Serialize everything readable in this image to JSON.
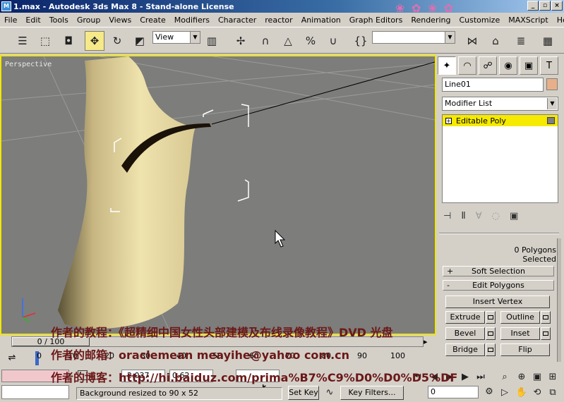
{
  "window": {
    "title": "1.max - Autodesk 3ds Max 8 - Stand-alone License",
    "controls": [
      "_",
      "▫",
      "×"
    ]
  },
  "menu": [
    "File",
    "Edit",
    "Tools",
    "Group",
    "Views",
    "Create",
    "Modifiers",
    "Character",
    "reactor",
    "Animation",
    "Graph Editors",
    "Rendering",
    "Customize",
    "MAXScript",
    "Help"
  ],
  "toolbar": {
    "coord_system": "View",
    "named_selection": ""
  },
  "viewport": {
    "label": "Perspective",
    "overlay_lines": [
      "作者的教程：《超精细中国女性头部建模及布线录像教程》DVD 光盘",
      "作者的邮箱：oraclemean meayihe@yahoo com.cn",
      "作者的博客：http://hi.baiduz.com/prima%B7%C9%D0%D0%D5%DF"
    ]
  },
  "command_panel": {
    "object_name": "Line01",
    "modifier_list": "Modifier List",
    "stack_item": "Editable Poly",
    "selection_status": "0 Polygons Selected",
    "rollouts": {
      "soft_selection": "Soft Selection",
      "edit_polygons": "Edit Polygons"
    },
    "buttons": {
      "insert_vertex": "Insert Vertex",
      "extrude": "Extrude",
      "outline": "Outline",
      "bevel": "Bevel",
      "inset": "Inset",
      "bridge": "Bridge",
      "flip": "Flip"
    },
    "signs": {
      "plus": "+",
      "minus": "-"
    }
  },
  "timeline": {
    "frame_label": "0 / 100",
    "current_frame": 0,
    "ticks": [
      "0",
      "10",
      "20",
      "30",
      "40",
      "50",
      "60",
      "70",
      "80",
      "90",
      "100"
    ]
  },
  "status": {
    "message": "Background resized to 90 x 52",
    "set_key": "Set Key",
    "key_filters": "Key Filters...",
    "frame_field": "0",
    "x_field": "-2.037",
    "y_field": "0.62"
  },
  "colors": {
    "viewport_border": "#f2e600",
    "viewport_bg": "#7d7d7b",
    "stack_highlight": "#f6ea00",
    "overlay_text": "#6b1818"
  }
}
